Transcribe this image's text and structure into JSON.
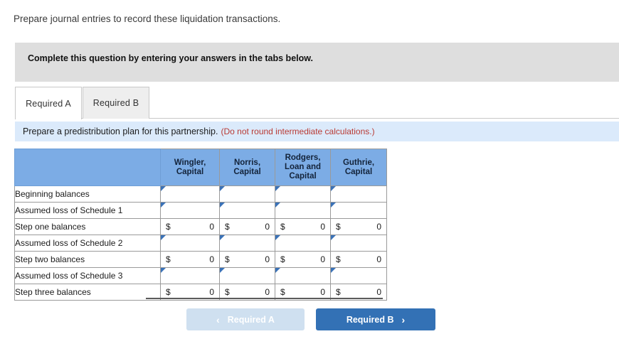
{
  "intro": {
    "text": "Prepare journal entries to record these liquidation transactions."
  },
  "callout": {
    "text": "Complete this question by entering your answers in the tabs below."
  },
  "tabs": [
    {
      "label": "Required A",
      "active": true
    },
    {
      "label": "Required B",
      "active": false
    }
  ],
  "requirement": {
    "text": "Prepare a predistribution plan for this partnership.",
    "note": "(Do not round intermediate calculations.)"
  },
  "table": {
    "row_label_header": "",
    "columns": [
      "Wingler, Capital",
      "Norris, Capital",
      "Rodgers, Loan and Capital",
      "Guthrie, Capital"
    ],
    "rows": [
      {
        "label": "Beginning balances",
        "type": "input",
        "values": [
          "",
          "",
          "",
          ""
        ]
      },
      {
        "label": "Assumed loss of Schedule 1",
        "type": "input",
        "values": [
          "",
          "",
          "",
          ""
        ]
      },
      {
        "label": "Step one balances",
        "type": "value",
        "currency": "$",
        "values": [
          "0",
          "0",
          "0",
          "0"
        ]
      },
      {
        "label": "Assumed loss of Schedule 2",
        "type": "input",
        "values": [
          "",
          "",
          "",
          ""
        ]
      },
      {
        "label": "Step two balances",
        "type": "value",
        "currency": "$",
        "values": [
          "0",
          "0",
          "0",
          "0"
        ]
      },
      {
        "label": "Assumed loss of Schedule 3",
        "type": "input",
        "values": [
          "",
          "",
          "",
          ""
        ]
      },
      {
        "label": "Step three balances",
        "type": "value",
        "currency": "$",
        "values": [
          "0",
          "0",
          "0",
          "0"
        ]
      }
    ]
  },
  "nav": {
    "prev_label": "Required A",
    "prev_icon": "chevron-left-icon",
    "prev_glyph": "‹",
    "next_label": "Required B",
    "next_icon": "chevron-right-icon",
    "next_glyph": "›"
  },
  "colors": {
    "header_blue": "#7cace5",
    "strip_blue": "#dbeafb",
    "callout_gray": "#dedede",
    "primary_blue": "#3371b5",
    "disabled_blue": "#cfe0f0",
    "note_red": "#b93a34",
    "input_border": "#4a7fbd"
  }
}
